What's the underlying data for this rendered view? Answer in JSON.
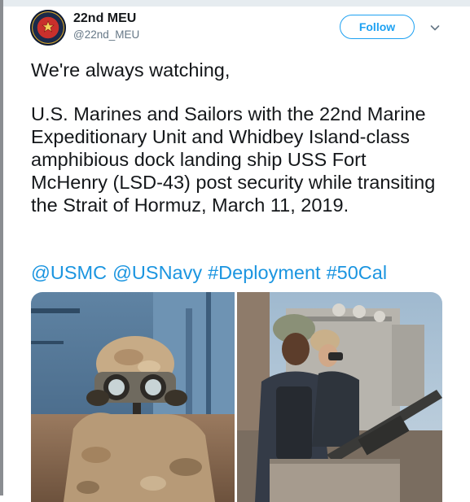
{
  "account": {
    "name": "22nd MEU",
    "handle": "@22nd_MEU"
  },
  "actions": {
    "follow_label": "Follow"
  },
  "tweet": {
    "line1": "We're always watching,",
    "body": "U.S. Marines and Sailors with the 22nd Marine Expeditionary Unit and Whidbey Island-class amphibious dock landing ship USS Fort McHenry (LSD-43) post security while transiting the Strait of Hormuz, March 11, 2019.",
    "tags": [
      "@USMC",
      "@USNavy",
      "#Deployment",
      "#50Cal"
    ]
  },
  "colors": {
    "link": "#1b95e0",
    "follow_border": "#1da1f2",
    "handle": "#657786",
    "text": "#14171a"
  },
  "icons": {
    "avatar": "meu-emblem-icon",
    "menu": "chevron-down-icon"
  }
}
